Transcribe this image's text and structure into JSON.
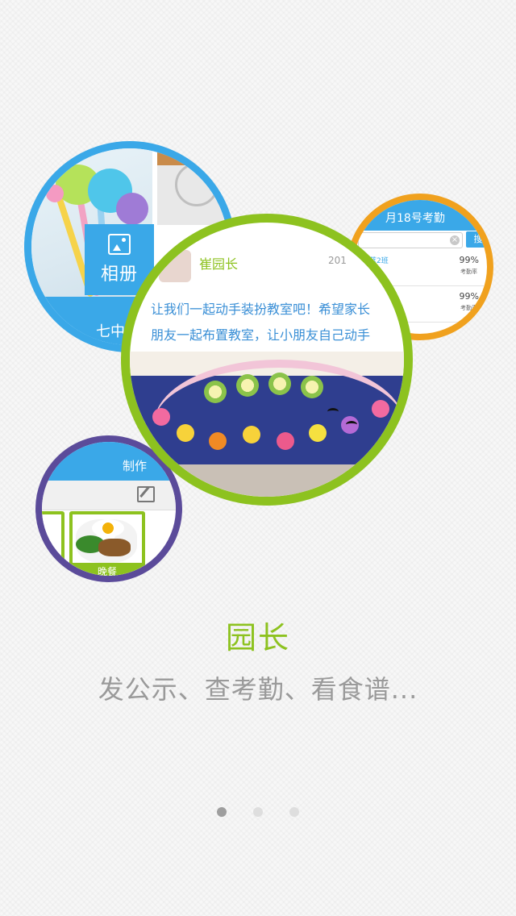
{
  "album": {
    "tile_label": "相册",
    "tile_icon": "image-icon",
    "band_text": "七中"
  },
  "attendance": {
    "header": "月18号考勤",
    "search_button": "搜",
    "clear_icon": "clear-icon",
    "rows": [
      {
        "class_name": "蓝2班",
        "percent": "99%",
        "rate_label": "考勤率"
      },
      {
        "class_name": "",
        "percent": "99%",
        "rate_label": "考勤率"
      }
    ]
  },
  "main_post": {
    "author": "崔园长",
    "date": "201",
    "text_line1": "让我们一起动手装扮教室吧！希望家长",
    "text_line2": "朋友一起布置教室，让小朋友自己动手"
  },
  "menu": {
    "header": "制作",
    "edit_icon": "edit-icon",
    "food_label": "晚餐"
  },
  "onboarding": {
    "title": "园长",
    "description": "发公示、查考勤、看食谱...",
    "page_count": 3,
    "active_page": 0
  },
  "colors": {
    "blue": "#3aa8e8",
    "green": "#8dc21f",
    "orange": "#f0a11e",
    "purple": "#5b4b9a",
    "gray_text": "#9a9a9a"
  }
}
